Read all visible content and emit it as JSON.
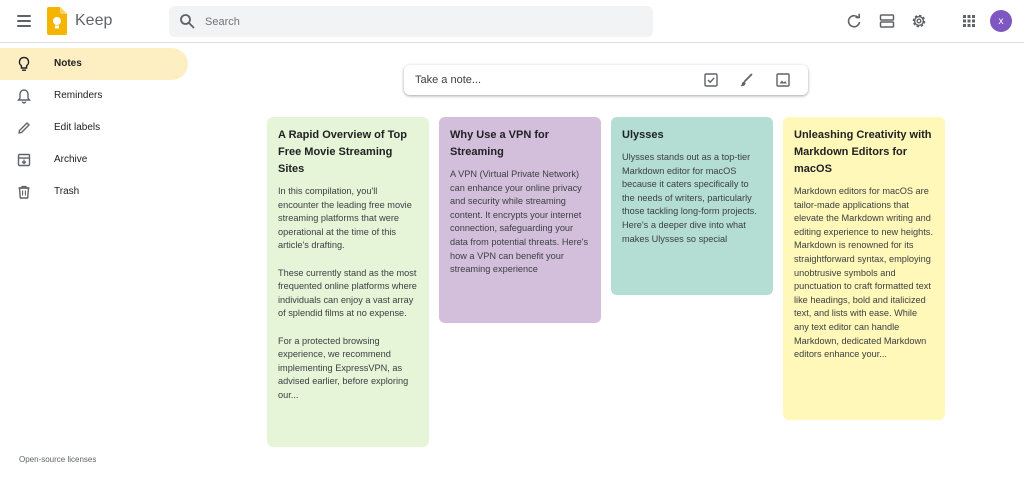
{
  "header": {
    "app_title": "Keep",
    "search": {
      "placeholder": "Search",
      "value": ""
    },
    "avatar_initial": "x",
    "icons": [
      "menu-icon",
      "keep-logo",
      "search-icon",
      "refresh-icon",
      "list-view-icon",
      "settings-icon",
      "apps-icon"
    ],
    "colors": {
      "avatar": "#7e57c2",
      "logo": "#f4b400",
      "search_bg": "#f1f3f4"
    }
  },
  "sidebar": {
    "items": [
      {
        "label": "Notes",
        "icon": "lightbulb-icon",
        "active": true
      },
      {
        "label": "Reminders",
        "icon": "bell-icon",
        "active": false
      },
      {
        "label": "Edit labels",
        "icon": "pencil-icon",
        "active": false
      },
      {
        "label": "Archive",
        "icon": "archive-icon",
        "active": false
      },
      {
        "label": "Trash",
        "icon": "trash-icon",
        "active": false
      }
    ],
    "footer_link": "Open-source licenses",
    "active_color": "#feefc3"
  },
  "take_note": {
    "placeholder": "Take a note...",
    "icons": [
      "checkbox-icon",
      "brush-icon",
      "image-icon"
    ]
  },
  "notes": [
    {
      "title": "A Rapid Overview of Top Free Movie Streaming Sites",
      "body": "In this compilation, you'll encounter the leading free movie streaming platforms that were operational at the time of this article's drafting.\n\nThese currently stand as the most frequented online platforms where individuals can enjoy a vast array of splendid films at no expense.\n\nFor a protected browsing experience, we recommend implementing ExpressVPN, as advised earlier, before exploring our...",
      "color": "#e6f4d7"
    },
    {
      "title": "Why Use a VPN for Streaming",
      "body": "A VPN (Virtual Private Network) can enhance your online privacy and security while streaming content. It encrypts your internet connection, safeguarding your data from potential threats. Here's how a VPN can benefit your streaming experience",
      "color": "#d3bfdb"
    },
    {
      "title": "Ulysses",
      "body": "Ulysses stands out as a top-tier Markdown editor for macOS because it caters specifically to the needs of writers, particularly those tackling long-form projects. Here's a deeper dive into what makes Ulysses so special",
      "color": "#b4ddd3"
    },
    {
      "title": "Unleashing Creativity with Markdown Editors for macOS",
      "body": "Markdown editors for macOS are tailor-made applications that elevate the Markdown writing and editing experience to new heights. Markdown is renowned for its straightforward syntax, employing unobtrusive symbols and punctuation to craft formatted text like headings, bold and italicized text, and lists with ease. While any text editor can handle Markdown, dedicated Markdown editors enhance your...",
      "color": "#fff8b8"
    }
  ]
}
